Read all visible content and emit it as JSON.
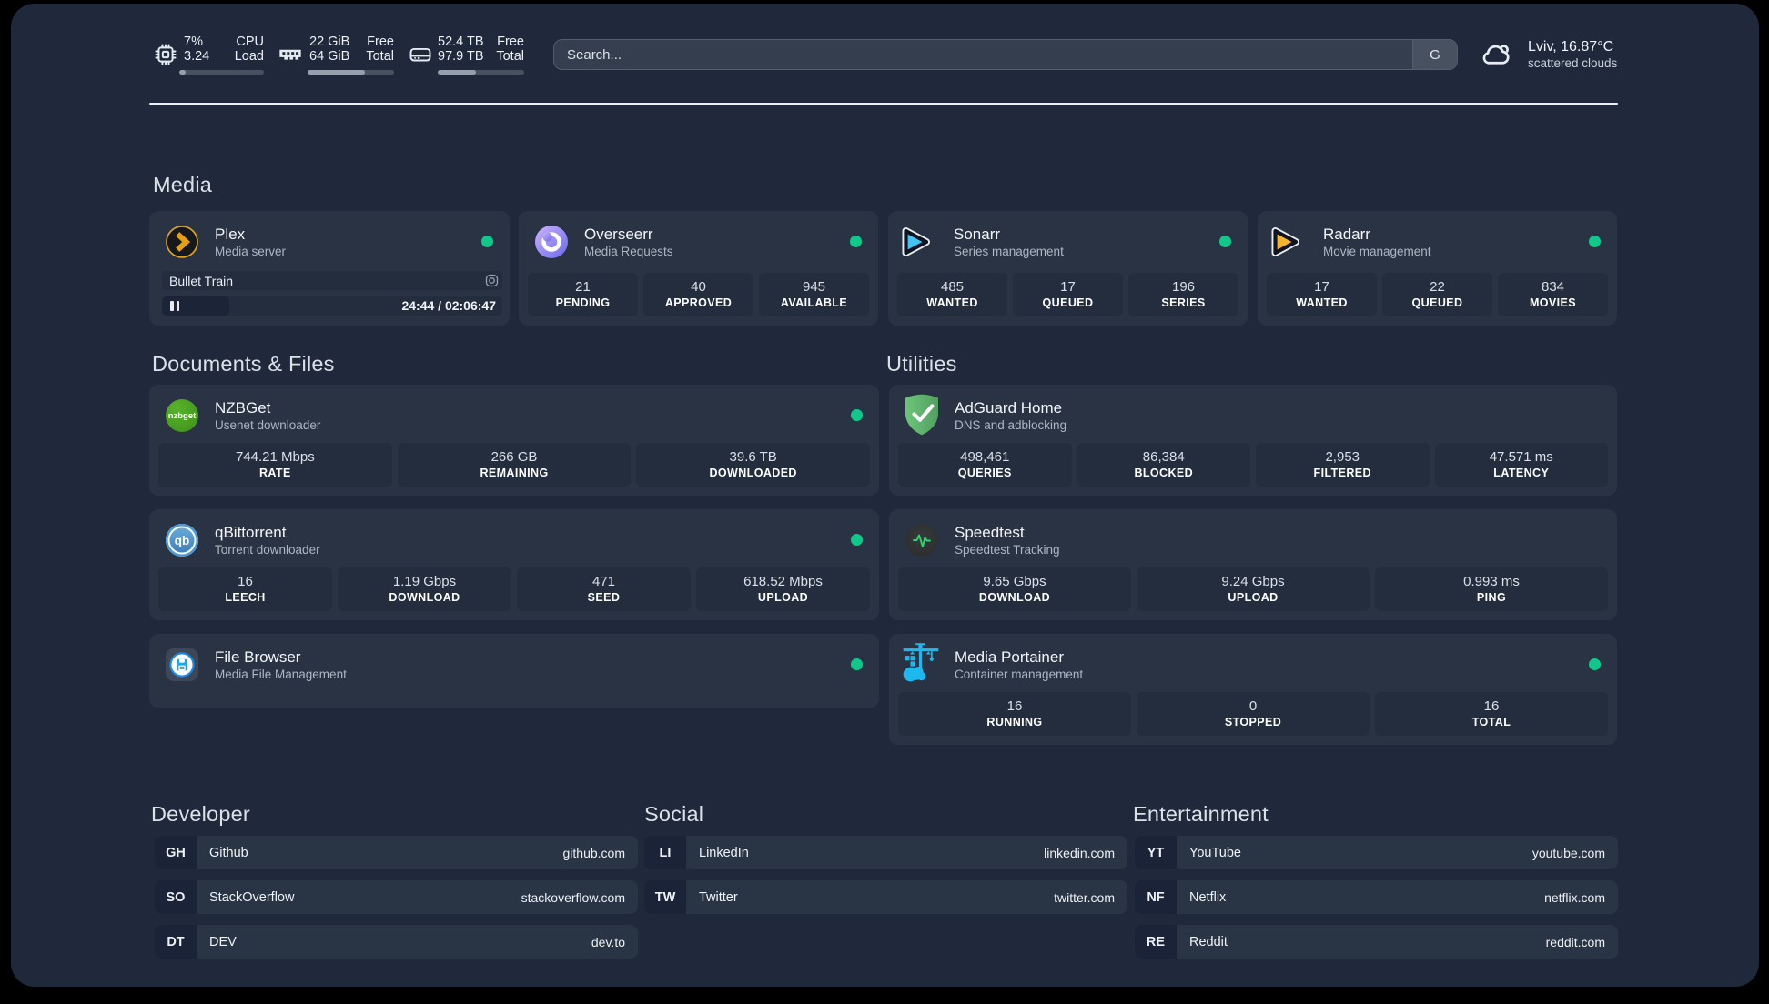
{
  "header": {
    "cpu": {
      "value1": "7%",
      "value2": "3.24",
      "label1": "CPU",
      "label2": "Load",
      "progress": 7
    },
    "memory": {
      "value1": "22 GiB",
      "value2": "64 GiB",
      "label1": "Free",
      "label2": "Total",
      "progress": 66
    },
    "disk": {
      "value1": "52.4 TB",
      "value2": "97.9 TB",
      "label1": "Free",
      "label2": "Total",
      "progress": 44
    },
    "search": {
      "placeholder": "Search...",
      "button_label": "G"
    },
    "weather": {
      "location": "Lviv, 16.87°C",
      "condition": "scattered clouds"
    }
  },
  "sections": {
    "media": "Media",
    "documents": "Documents & Files",
    "utilities": "Utilities",
    "developer": "Developer",
    "social": "Social",
    "entertainment": "Entertainment"
  },
  "apps": {
    "plex": {
      "name": "Plex",
      "desc": "Media server",
      "now_playing": "Bullet Train",
      "time": "24:44 / 02:06:47",
      "progress": 19.7
    },
    "overseerr": {
      "name": "Overseerr",
      "desc": "Media Requests",
      "stats": [
        {
          "value": "21",
          "label": "PENDING"
        },
        {
          "value": "40",
          "label": "APPROVED"
        },
        {
          "value": "945",
          "label": "AVAILABLE"
        }
      ]
    },
    "sonarr": {
      "name": "Sonarr",
      "desc": "Series management",
      "stats": [
        {
          "value": "485",
          "label": "WANTED"
        },
        {
          "value": "17",
          "label": "QUEUED"
        },
        {
          "value": "196",
          "label": "SERIES"
        }
      ]
    },
    "radarr": {
      "name": "Radarr",
      "desc": "Movie management",
      "stats": [
        {
          "value": "17",
          "label": "WANTED"
        },
        {
          "value": "22",
          "label": "QUEUED"
        },
        {
          "value": "834",
          "label": "MOVIES"
        }
      ]
    },
    "nzbget": {
      "name": "NZBGet",
      "desc": "Usenet downloader",
      "icon_text": "nzbget",
      "stats": [
        {
          "value": "744.21 Mbps",
          "label": "RATE"
        },
        {
          "value": "266 GB",
          "label": "REMAINING"
        },
        {
          "value": "39.6 TB",
          "label": "DOWNLOADED"
        }
      ]
    },
    "qbittorrent": {
      "name": "qBittorrent",
      "desc": "Torrent downloader",
      "icon_text": "qb",
      "stats": [
        {
          "value": "16",
          "label": "LEECH"
        },
        {
          "value": "1.19 Gbps",
          "label": "DOWNLOAD"
        },
        {
          "value": "471",
          "label": "SEED"
        },
        {
          "value": "618.52 Mbps",
          "label": "UPLOAD"
        }
      ]
    },
    "filebrowser": {
      "name": "File Browser",
      "desc": "Media File Management"
    },
    "adguard": {
      "name": "AdGuard Home",
      "desc": "DNS and adblocking",
      "stats": [
        {
          "value": "498,461",
          "label": "QUERIES"
        },
        {
          "value": "86,384",
          "label": "BLOCKED"
        },
        {
          "value": "2,953",
          "label": "FILTERED"
        },
        {
          "value": "47.571 ms",
          "label": "LATENCY"
        }
      ]
    },
    "speedtest": {
      "name": "Speedtest",
      "desc": "Speedtest Tracking",
      "stats": [
        {
          "value": "9.65 Gbps",
          "label": "DOWNLOAD"
        },
        {
          "value": "9.24 Gbps",
          "label": "UPLOAD"
        },
        {
          "value": "0.993 ms",
          "label": "PING"
        }
      ]
    },
    "portainer": {
      "name": "Media Portainer",
      "desc": "Container management",
      "stats": [
        {
          "value": "16",
          "label": "RUNNING"
        },
        {
          "value": "0",
          "label": "STOPPED"
        },
        {
          "value": "16",
          "label": "TOTAL"
        }
      ]
    }
  },
  "bookmarks": {
    "developer": [
      {
        "abbr": "GH",
        "name": "Github",
        "url": "github.com"
      },
      {
        "abbr": "SO",
        "name": "StackOverflow",
        "url": "stackoverflow.com"
      },
      {
        "abbr": "DT",
        "name": "DEV",
        "url": "dev.to"
      }
    ],
    "social": [
      {
        "abbr": "LI",
        "name": "LinkedIn",
        "url": "linkedin.com"
      },
      {
        "abbr": "TW",
        "name": "Twitter",
        "url": "twitter.com"
      }
    ],
    "entertainment": [
      {
        "abbr": "YT",
        "name": "YouTube",
        "url": "youtube.com"
      },
      {
        "abbr": "NF",
        "name": "Netflix",
        "url": "netflix.com"
      },
      {
        "abbr": "RE",
        "name": "Reddit",
        "url": "reddit.com"
      }
    ]
  },
  "colors": {
    "accent_green": "#0fc98a"
  }
}
